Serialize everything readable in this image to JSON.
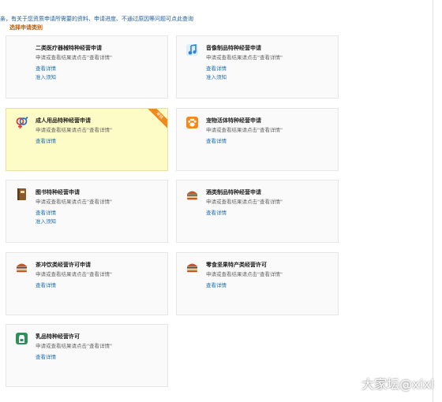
{
  "notice": "亲，有关于您资质申请所需要的资料、申请进度、不通过原因等问题可点此查询",
  "section_title": "选择申请类别",
  "cards": [
    {
      "title": "二类医疗器械特种经营申请",
      "desc": "申请或查看结果请点击\"查看详情\"",
      "link1": "查看详情",
      "link2": "准入须知",
      "icon": "blank-icon"
    },
    {
      "title": "音像制品特种经营申请",
      "desc": "申请或查看结果请点击\"查看详情\"",
      "link1": "查看详情",
      "link2": "准入须知",
      "icon": "music-note-icon"
    },
    {
      "title": "成人用品特种经营申请",
      "desc": "申请或查看结果请点击\"查看详情\"",
      "link1": "查看详情",
      "badge": "审核",
      "icon": "gender-symbols-icon"
    },
    {
      "title": "宠物活体特种经营申请",
      "desc": "申请或查看结果请点击\"查看详情\"",
      "link1": "查看详情",
      "icon": "paw-icon"
    },
    {
      "title": "图书特种经营申请",
      "desc": "申请或查看结果请点击\"查看详情\"",
      "link1": "查看详情",
      "link2": "准入须知",
      "icon": "book-icon"
    },
    {
      "title": "酒类制品特种经营申请",
      "desc": "申请或查看结果请点击\"查看详情\"",
      "link1": "查看详情",
      "icon": "food-icon"
    },
    {
      "title": "茶冲饮类经营许可申请",
      "desc": "申请或查看结果请点击\"查看详情\"",
      "link1": "查看详情",
      "icon": "food-icon"
    },
    {
      "title": "零食坚果特产类经营许可",
      "desc": "申请或查看结果请点击\"查看详情\"",
      "link1": "查看详情",
      "icon": "food-icon"
    },
    {
      "title": "乳品特种经营许可",
      "desc": "申请或查看结果请点击\"查看详情\"",
      "link1": "查看详情",
      "icon": "milk-icon"
    }
  ],
  "watermark": "大家坛@xixl",
  "colors": {
    "selected_bg": "#fefcc6",
    "link": "#1f6fb5",
    "badge": "#f08a1c"
  }
}
